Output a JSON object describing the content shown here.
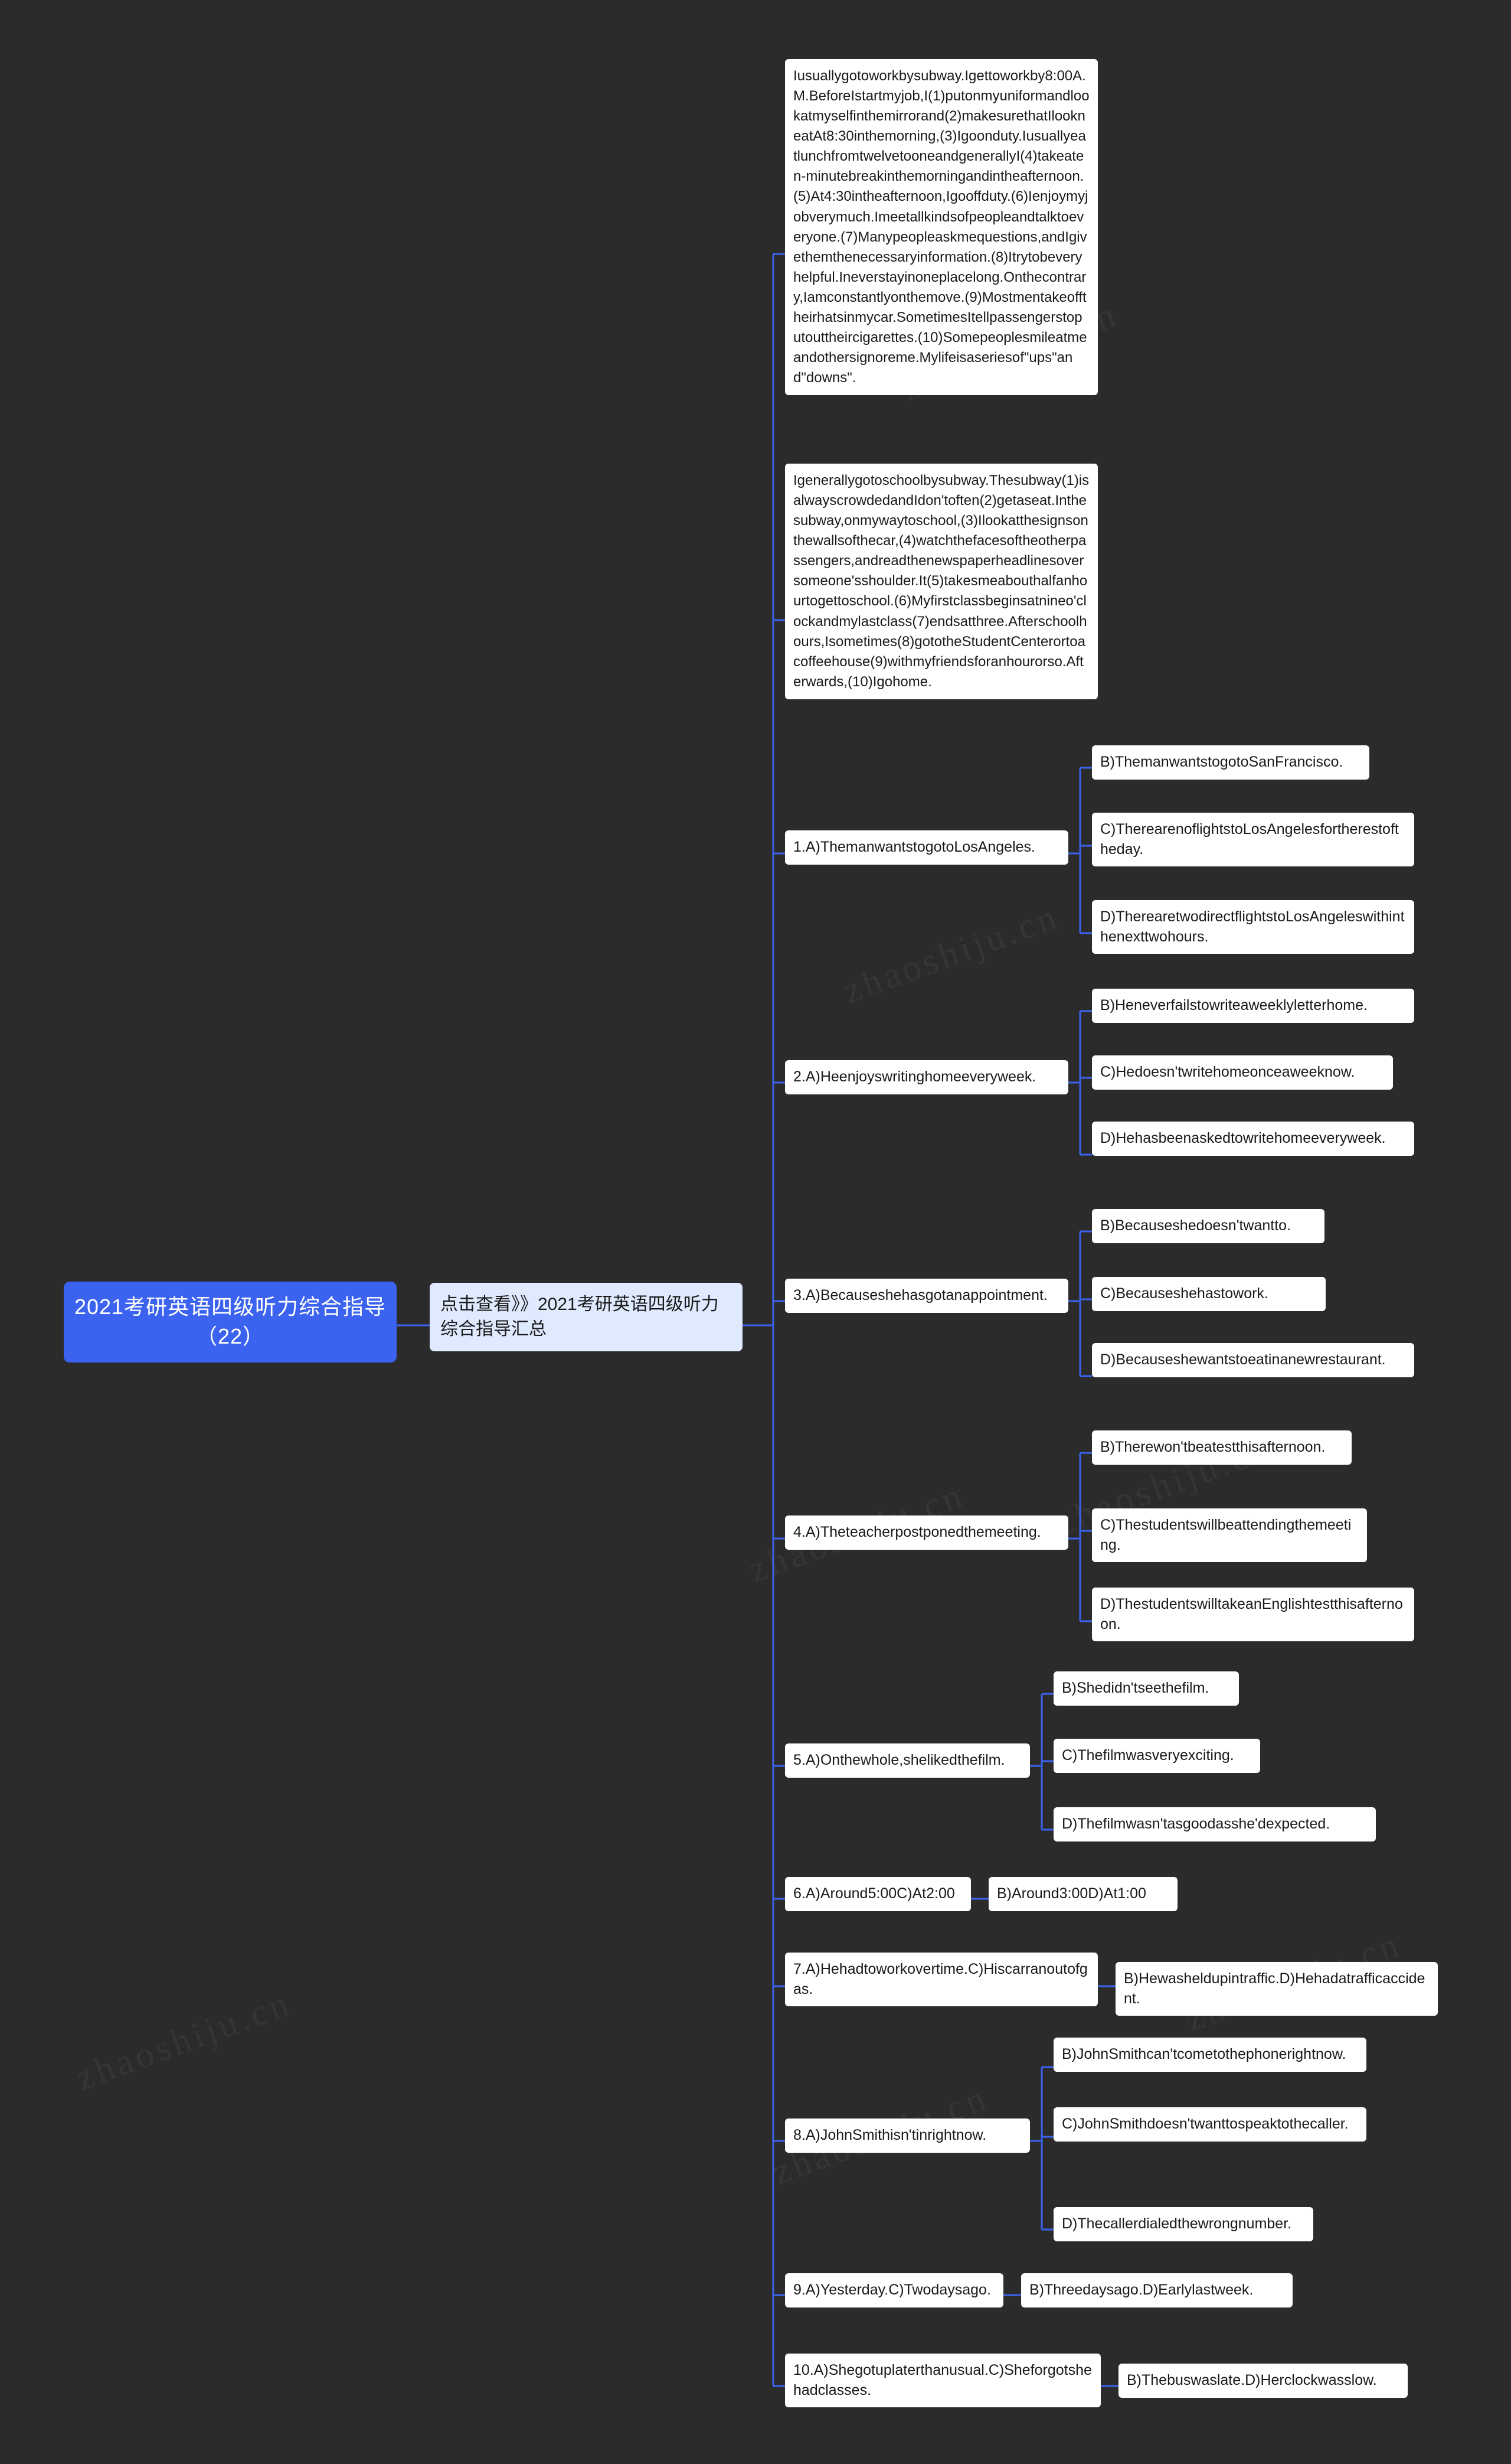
{
  "watermarks": [
    "找试卷网 zhaoshiju.cn",
    "zhaoshiju.cn",
    "zhaoshiju.cn",
    "zhaoshiju.cn",
    "zhaoshiju.cn",
    "zhaoshiju.cn"
  ],
  "root": {
    "title": "2021考研英语四级听力综合指导（22）"
  },
  "subtopic": {
    "label": "点击查看》》2021考研英语四级听力综合指导汇总"
  },
  "passages": [
    {
      "id": "passage-1",
      "text": "Iusuallygotoworkbysubway.Igettoworkby8:00A.M.BeforeIstartmyjob,I(1)putonmyuniformandlookatmyselfinthemirrorand(2)makesurethatIlookneatAt8:30inthemorning,(3)Igoonduty.IusuallyeatlunchfromtwelvetooneandgenerallyI(4)takeaten-minutebreakinthemorningandintheafternoon.(5)At4:30intheafternoon,Igooffduty.(6)Ienjoymyjobverymuch.Imeetallkindsofpeopleandtalktoeveryone.(7)Manypeopleaskmequestions,andIgivethemthenecessaryinformation.(8)Itrytobeveryhelpful.Ineverstayinoneplacelong.Onthecontrary,Iamconstantlyonthemove.(9)Mostmentakeofftheirhatsinmycar.SometimesItellpassengerstoputouttheircigarettes.(10)Somepeoplesmileatmeandothersignoreme.Mylifeisaseriesof\"ups\"and\"downs\"."
    },
    {
      "id": "passage-2",
      "text": "Igenerallygotoschoolbysubway.Thesubway(1)isalwayscrowdedandIdon'toften(2)getaseat.Inthesubway,onmywaytoschool,(3)Ilookatthesignsonthewallsofthecar,(4)watchthefacesoftheotherpassengers,andreadthenewspaperheadlinesoversomeone'sshoulder.It(5)takesmeabouthalfanhourtogettoschool.(6)Myfirstclassbeginsatnineo'clockandmylastclass(7)endsatthree.Afterschoolhours,Isometimes(8)gototheStudentCenterortoacoffeehouse(9)withmyfriendsforanhourorso.Afterwards,(10)Igohome."
    }
  ],
  "questions": [
    {
      "id": "q1",
      "stem": "1.A)ThemanwantstogotoLosAngeles.",
      "options": [
        "B)ThemanwantstogotoSanFrancisco.",
        "C)TherearenoflightstoLosAngelesfortherestoftheday.",
        "D)TherearetwodirectflightstoLosAngeleswithinthenexttwohours."
      ]
    },
    {
      "id": "q2",
      "stem": "2.A)Heenjoyswritinghomeeveryweek.",
      "options": [
        "B)Heneverfailstowriteaweeklyletterhome.",
        "C)Hedoesn'twritehomeonceaweeknow.",
        "D)Hehasbeenaskedtowritehomeeveryweek."
      ]
    },
    {
      "id": "q3",
      "stem": "3.A)Becausesheh​asgotanappointment.",
      "options": [
        "B)Becauseshedoesn'twantto.",
        "C)Becauseshehastowork.",
        "D)Becauseshewantstoeatinanewrestaurant."
      ]
    },
    {
      "id": "q4",
      "stem": "4.A)Theteacherpostponedthemeeting.",
      "options": [
        "B)Therewon'tbeatestthisafternoon.",
        "C)Thestudentswillbeattendingthemeeting.",
        "D)ThestudentswilltakeanEnglishtestthisafternoon."
      ]
    },
    {
      "id": "q5",
      "stem": "5.A)Onthewhole,shelikedthefilm.",
      "options": [
        "B)Shedidn'tseethefilm.",
        "C)Thefilmwasveryexciting.",
        "D)Thefilmwasn'tasgoodasshe'dexpected."
      ]
    },
    {
      "id": "q6",
      "stem": "6.A)Around5:00C)At2:00",
      "options": [
        "B)Around3:00D)At1:00"
      ]
    },
    {
      "id": "q7",
      "stem": "7.A)Hehadtoworkovertime.C)Hiscarranoutofgas.",
      "options": [
        "B)Hewasheldupintraffic.D)Hehadatrafficaccident."
      ]
    },
    {
      "id": "q8",
      "stem": "8.A)JohnSmithisn'tinrightnow.",
      "options": [
        "B)JohnSmithcan'tcometothephonerightnow.",
        "C)JohnSmithdoesn'twanttospeaktothecaller.",
        "D)Thecallerdialedthewrongnumber."
      ]
    },
    {
      "id": "q9",
      "stem": "9.A)Yesterday.C)Twodaysago.",
      "options": [
        "B)Threedaysago.D)Earlylastweek."
      ]
    },
    {
      "id": "q10",
      "stem": "10.A)Shegotupl​aterthanusual.C)Sheforgotshehadclasses.",
      "options": [
        "B)Thebuswaslate.D)Herclockwasslow."
      ]
    }
  ],
  "colors": {
    "background": "#2b2b2b",
    "root_bg": "#3b63f0",
    "sub_bg": "#dfeaff",
    "node_bg": "#ffffff",
    "link": "#3b63f0"
  }
}
